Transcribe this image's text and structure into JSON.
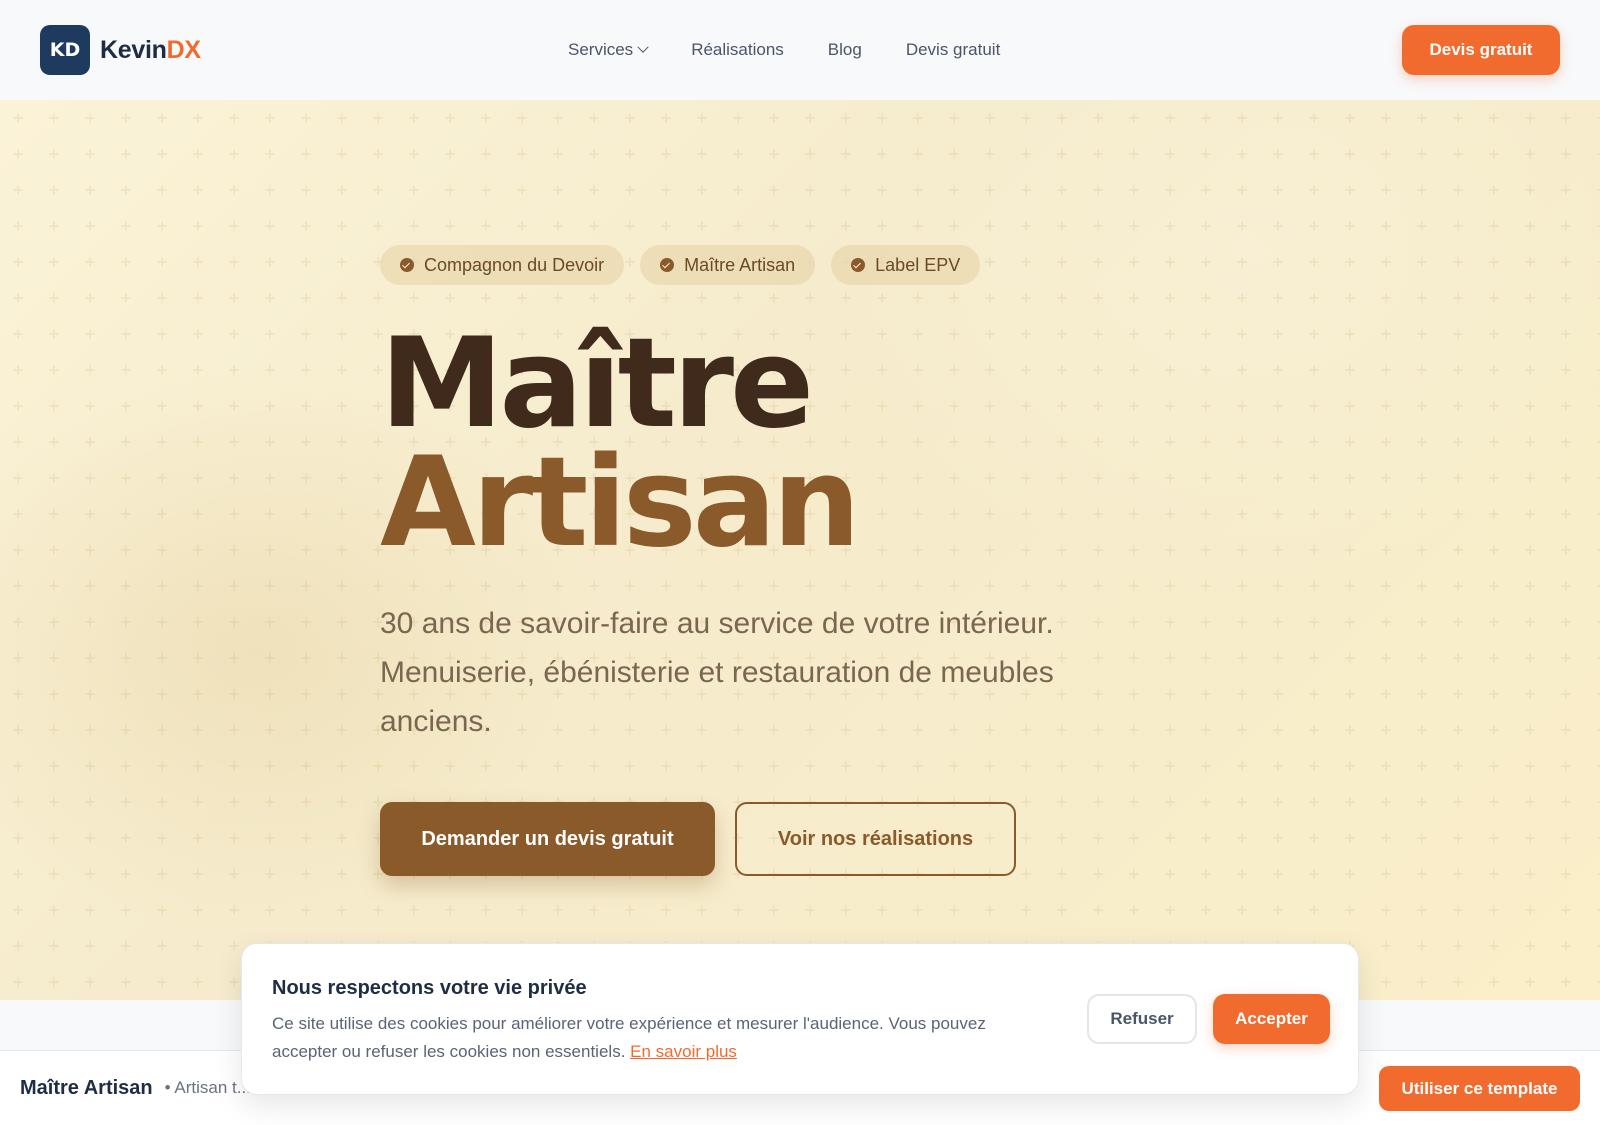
{
  "header": {
    "logo_badge": "KD",
    "logo_name": "Kevin",
    "logo_accent": "DX",
    "nav": [
      {
        "label": "Services",
        "has_dropdown": true
      },
      {
        "label": "Réalisations"
      },
      {
        "label": "Blog"
      },
      {
        "label": "Devis gratuit"
      }
    ],
    "cta_label": "Devis gratuit"
  },
  "hero": {
    "badges": [
      "Compagnon du Devoir",
      "Maître Artisan",
      "Label EPV"
    ],
    "title_line1": "Maître",
    "title_line2": "Artisan",
    "subtitle": "30 ans de savoir-faire au service de votre intérieur. Menuiserie, ébénisterie et restauration de meubles anciens.",
    "primary_cta": "Demander un devis gratuit",
    "secondary_cta": "Voir nos réalisations"
  },
  "cookie": {
    "title": "Nous respectons votre vie privée",
    "text": "Ce site utilise des cookies pour améliorer votre expérience et mesurer l'audience. Vous pouvez accepter ou refuser les cookies non essentiels.",
    "link": "En savoir plus",
    "refuse_label": "Refuser",
    "accept_label": "Accepter"
  },
  "bottom_bar": {
    "title": "Maître Artisan",
    "subtitle": "• Artisan t...",
    "cta_label": "Utiliser ce template"
  },
  "colors": {
    "brand_navy": "#1e3a5f",
    "accent_orange": "#f26b2e",
    "wood_brown": "#8b5a2b",
    "dark_brown": "#3f2a1c"
  }
}
